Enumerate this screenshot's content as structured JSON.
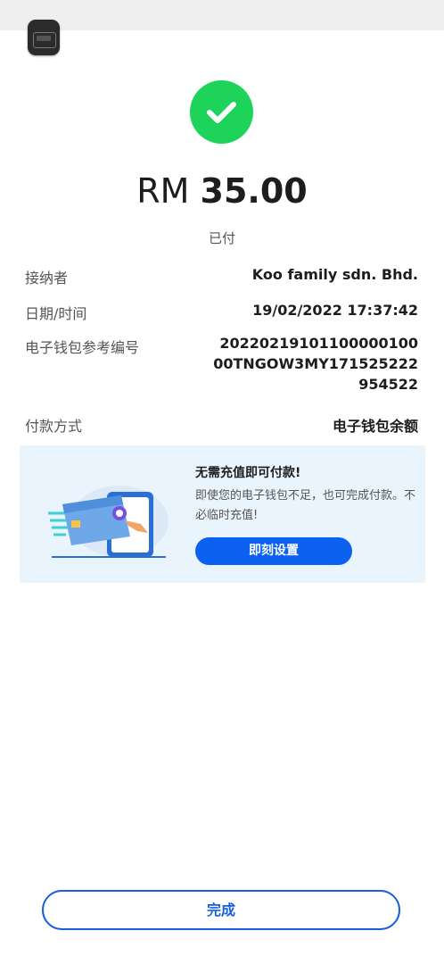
{
  "icons": {
    "app": "app-icon",
    "success": "check-icon",
    "promo_illustration": "wallet-card-illustration"
  },
  "colors": {
    "success": "#1dd35a",
    "accent": "#0b61f0",
    "promo_bg": "#eaf4fd"
  },
  "payment": {
    "currency": "RM",
    "amount": "35.00",
    "status": "已付"
  },
  "details": [
    {
      "label": "接纳者",
      "value": "Koo family sdn. Bhd."
    },
    {
      "label": "日期/时间",
      "value": "19/02/2022 17:37:42"
    },
    {
      "label": "电子钱包参考编号",
      "value": "20220219101100000100 00TNGOW3MY171525222 954522"
    },
    {
      "label": "付款方式",
      "value": "电子钱包余额"
    }
  ],
  "promo": {
    "title": "无需充值即可付款!",
    "description": "即使您的电子钱包不足，也可完成付款。不必临时充值!",
    "button_label": "即刻设置"
  },
  "footer": {
    "done_label": "完成"
  }
}
